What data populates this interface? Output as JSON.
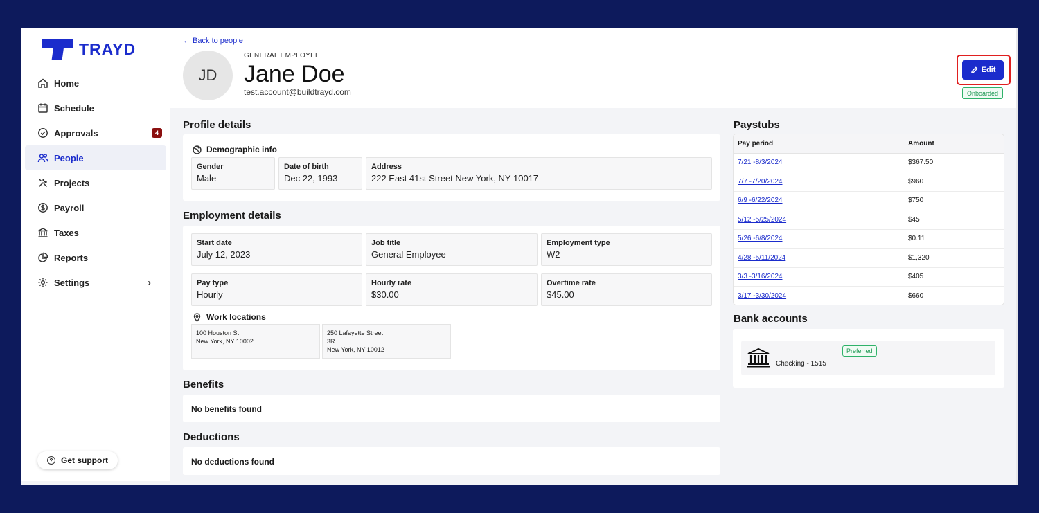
{
  "brand": {
    "name": "TRAYD",
    "color": "#1b2ccc"
  },
  "sidebar": {
    "items": [
      {
        "label": "Home",
        "icon": "home-icon"
      },
      {
        "label": "Schedule",
        "icon": "calendar-icon"
      },
      {
        "label": "Approvals",
        "icon": "check-circle-icon",
        "badge": "4"
      },
      {
        "label": "People",
        "icon": "people-icon",
        "active": true
      },
      {
        "label": "Projects",
        "icon": "tools-icon"
      },
      {
        "label": "Payroll",
        "icon": "dollar-icon"
      },
      {
        "label": "Taxes",
        "icon": "bank-icon"
      },
      {
        "label": "Reports",
        "icon": "pie-chart-icon"
      },
      {
        "label": "Settings",
        "icon": "gear-icon",
        "chevron": "›"
      }
    ],
    "support_label": "Get support"
  },
  "header": {
    "back_label": "← Back to people",
    "initials": "JD",
    "role": "GENERAL EMPLOYEE",
    "name": "Jane Doe",
    "email": "test.account@buildtrayd.com",
    "edit_label": "Edit",
    "status": "Onboarded"
  },
  "profile": {
    "title": "Profile details",
    "demographic_title": "Demographic info",
    "gender_label": "Gender",
    "gender": "Male",
    "dob_label": "Date of birth",
    "dob": "Dec 22, 1993",
    "address_label": "Address",
    "address": "222 East 41st Street New York, NY 10017"
  },
  "employment": {
    "title": "Employment details",
    "start_label": "Start date",
    "start": "July 12, 2023",
    "job_label": "Job title",
    "job": "General Employee",
    "type_label": "Employment type",
    "type": "W2",
    "pay_type_label": "Pay type",
    "pay_type": "Hourly",
    "hourly_label": "Hourly rate",
    "hourly": "$30.00",
    "overtime_label": "Overtime rate",
    "overtime": "$45.00",
    "locations_title": "Work locations",
    "locations": [
      {
        "line1": "100 Houston St",
        "line2": "New York, NY 10002",
        "line3": ""
      },
      {
        "line1": "250 Lafayette Street",
        "line2": "3R",
        "line3": "New York, NY 10012"
      }
    ]
  },
  "benefits": {
    "title": "Benefits",
    "empty": "No benefits found"
  },
  "deductions": {
    "title": "Deductions",
    "empty": "No deductions found"
  },
  "paystubs": {
    "title": "Paystubs",
    "col_period": "Pay period",
    "col_amount": "Amount",
    "rows": [
      {
        "period": "7/21 -8/3/2024",
        "amount": "$367.50"
      },
      {
        "period": "7/7 -7/20/2024",
        "amount": "$960"
      },
      {
        "period": "6/9 -6/22/2024",
        "amount": "$750"
      },
      {
        "period": "5/12 -5/25/2024",
        "amount": "$45"
      },
      {
        "period": "5/26 -6/8/2024",
        "amount": "$0.11"
      },
      {
        "period": "4/28 -5/11/2024",
        "amount": "$1,320"
      },
      {
        "period": "3/3 -3/16/2024",
        "amount": "$405"
      },
      {
        "period": "3/17 -3/30/2024",
        "amount": "$660"
      }
    ]
  },
  "bank": {
    "title": "Bank accounts",
    "account": "Checking - 1515",
    "preferred": "Preferred"
  }
}
